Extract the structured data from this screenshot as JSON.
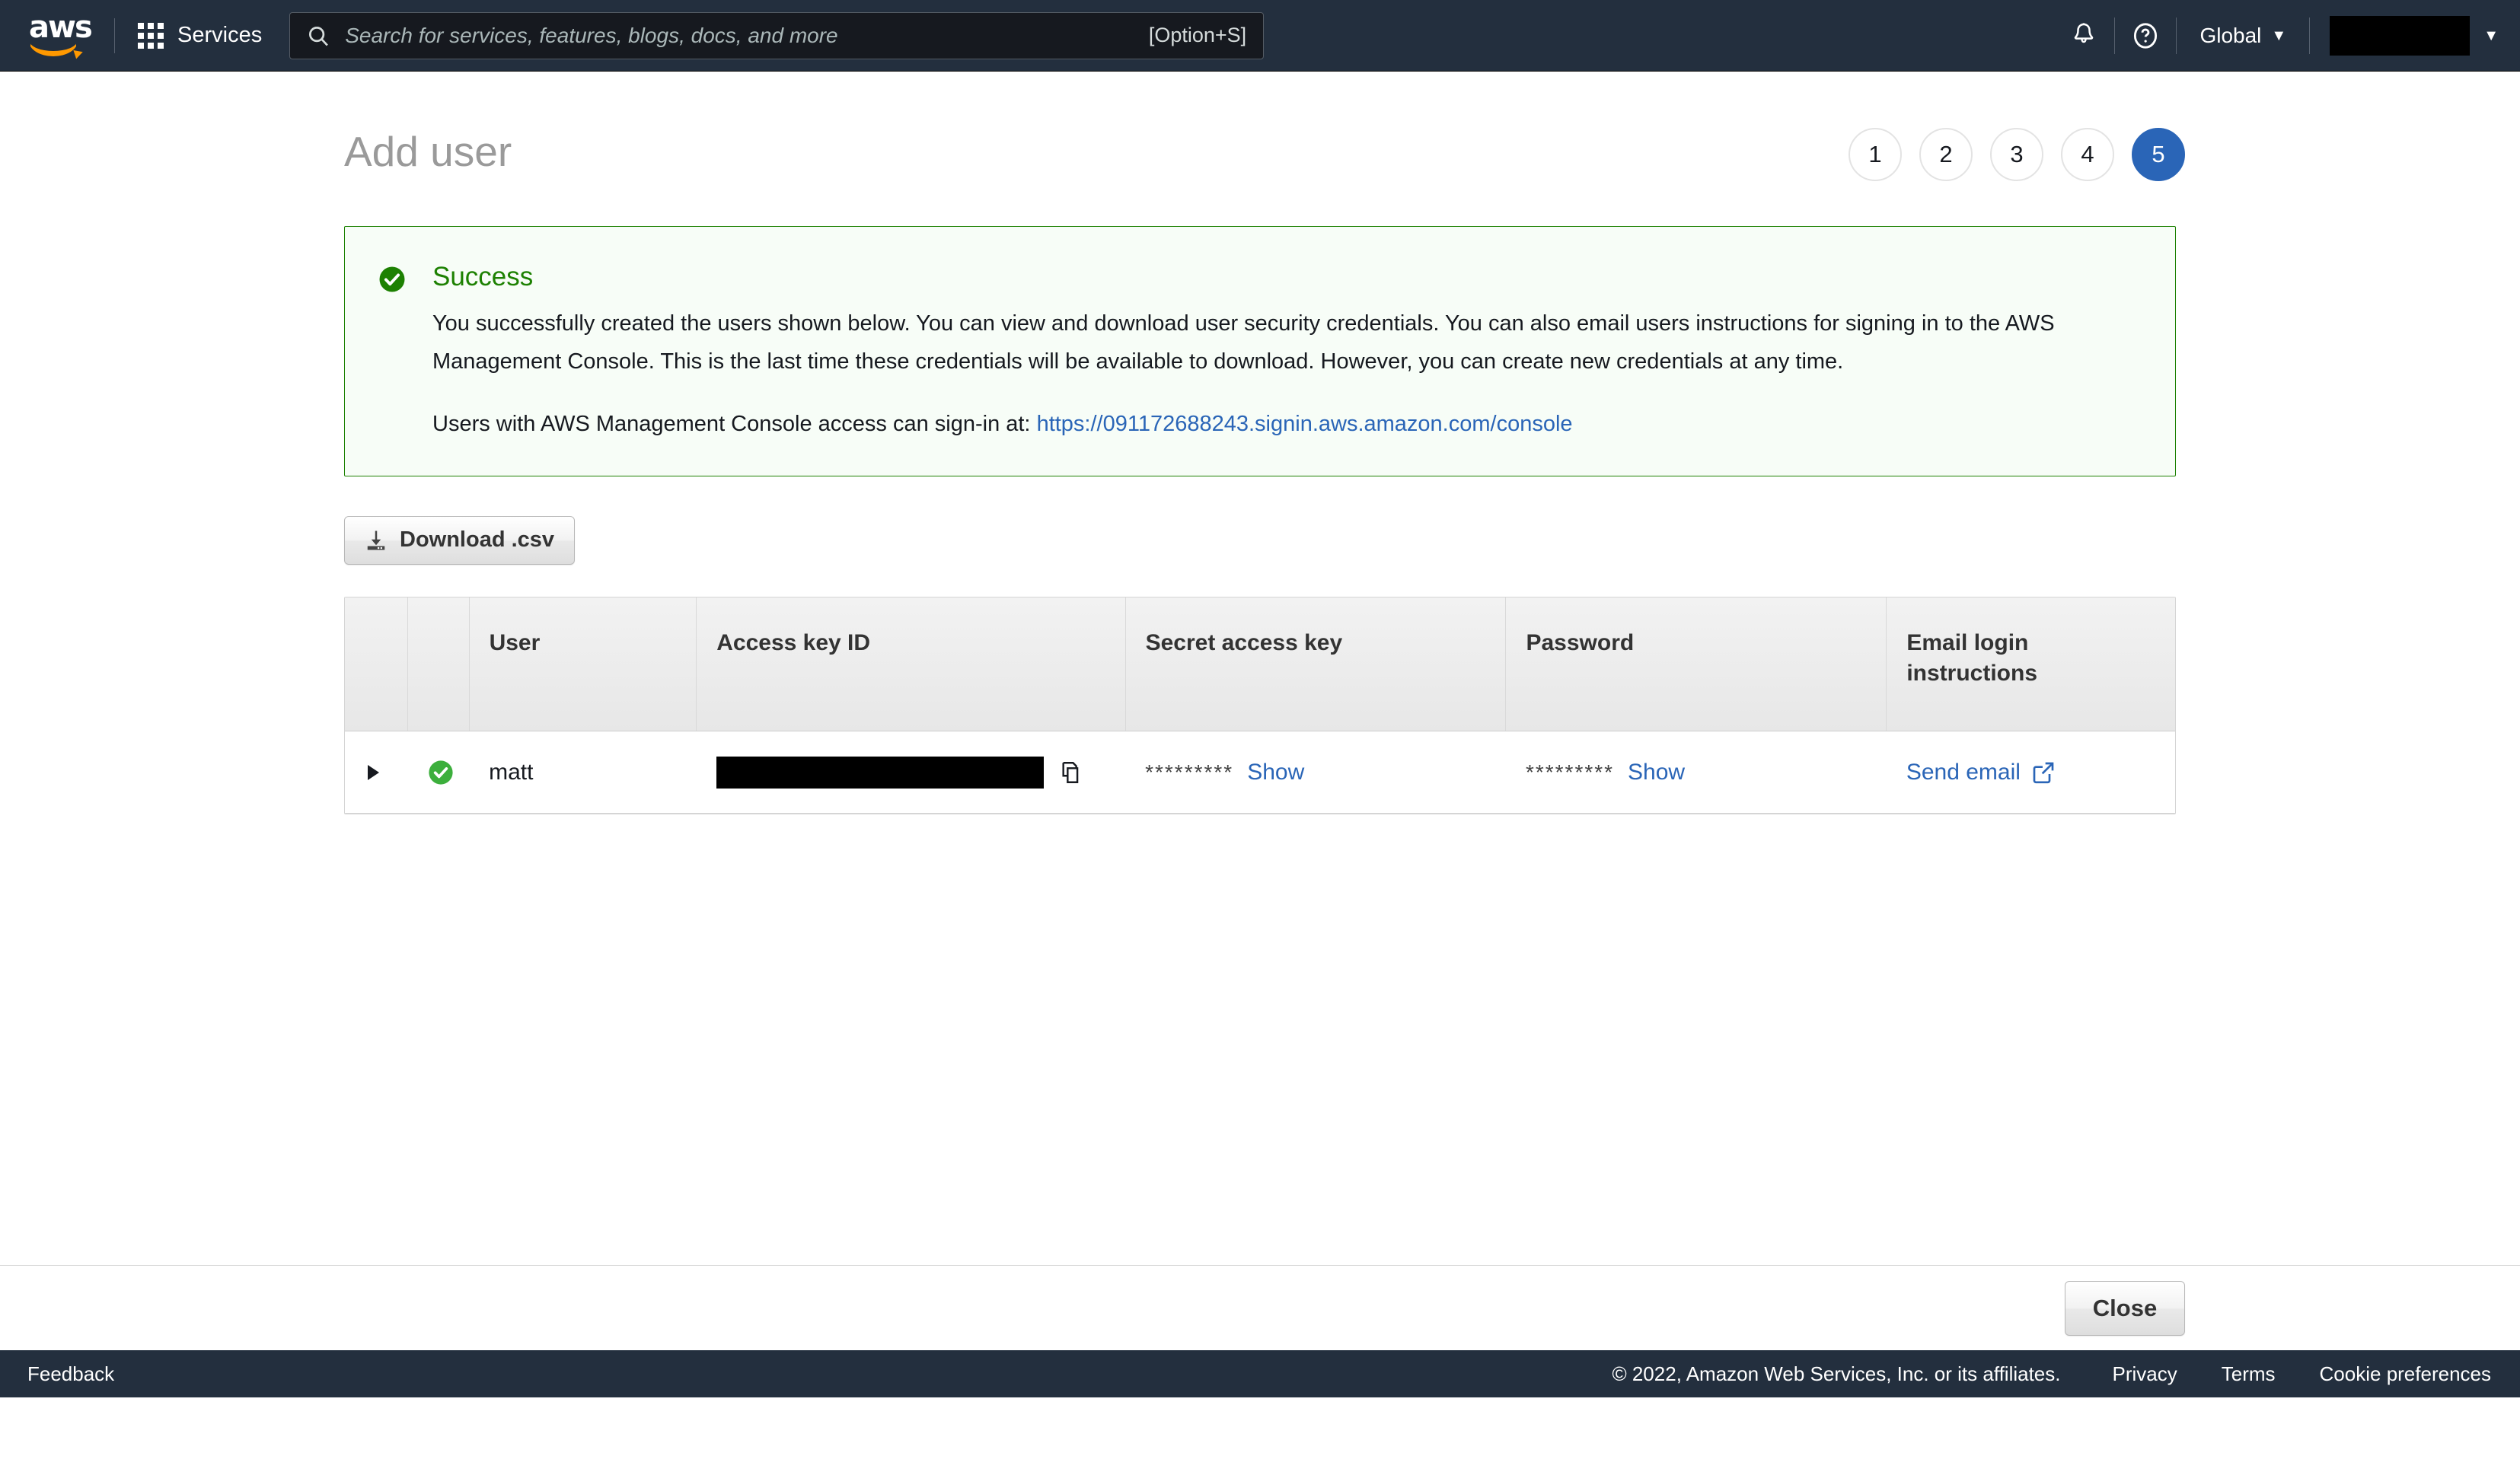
{
  "topnav": {
    "logo_wordmark": "aws",
    "services_label": "Services",
    "search": {
      "placeholder": "Search for services, features, blogs, docs, and more",
      "value": "",
      "shortcut": "[Option+S]"
    },
    "notifications_icon": "bell-icon",
    "help_icon": "question-circle-icon",
    "region_label": "Global",
    "region_caret": "▼",
    "account_label": "",
    "account_caret": "▼",
    "bg_color": "#232f3e"
  },
  "page": {
    "title": "Add user",
    "steps": [
      {
        "label": "1",
        "active": false
      },
      {
        "label": "2",
        "active": false
      },
      {
        "label": "3",
        "active": false
      },
      {
        "label": "4",
        "active": false
      },
      {
        "label": "5",
        "active": true
      }
    ],
    "active_step_color": "#2a65b7"
  },
  "alert": {
    "icon": "success-check-icon",
    "title": "Success",
    "title_color": "#1d8102",
    "border_color": "#1d8102",
    "background_color": "#f7fdf7",
    "body": "You successfully created the users shown below. You can view and download user security credentials. You can also email users instructions for signing in to the AWS Management Console. This is the last time these credentials will be available to download. However, you can create new credentials at any time.",
    "signin_prefix": "Users with AWS Management Console access can sign-in at: ",
    "signin_url": "https://091172688243.signin.aws.amazon.com/console"
  },
  "download": {
    "label": "Download .csv",
    "icon": "download-icon"
  },
  "table": {
    "columns": [
      {
        "key": "expand",
        "label": ""
      },
      {
        "key": "status",
        "label": ""
      },
      {
        "key": "user",
        "label": "User"
      },
      {
        "key": "access_key_id",
        "label": "Access key ID"
      },
      {
        "key": "secret_access_key",
        "label": "Secret access key"
      },
      {
        "key": "password",
        "label": "Password"
      },
      {
        "key": "email_login",
        "label": "Email login instructions"
      }
    ],
    "rows": [
      {
        "expand_icon": "chevron-right-icon",
        "status_icon": "success-check-icon",
        "user": "matt",
        "access_key_id": "",
        "access_key_redacted": true,
        "copy_icon": "copy-icon",
        "secret_access_key_mask": "*********",
        "secret_access_key_action": "Show",
        "password_mask": "*********",
        "password_action": "Show",
        "email_login_label": "Send email",
        "email_login_icon": "external-link-icon"
      }
    ]
  },
  "action_bar": {
    "close_label": "Close"
  },
  "footer": {
    "feedback_label": "Feedback",
    "copyright": "© 2022, Amazon Web Services, Inc. or its affiliates.",
    "privacy_label": "Privacy",
    "terms_label": "Terms",
    "cookie_label": "Cookie preferences"
  }
}
